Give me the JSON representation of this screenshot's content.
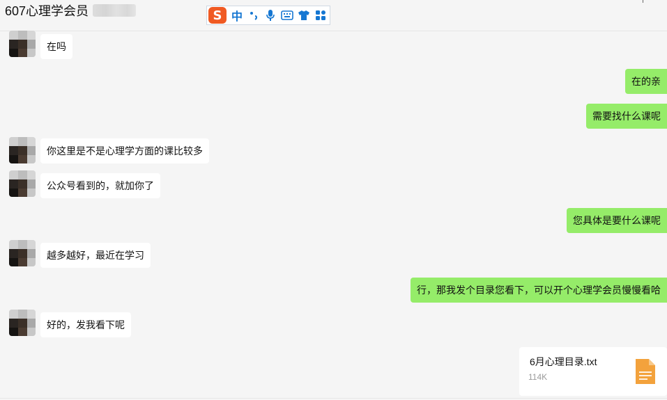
{
  "header": {
    "title": "607心理学会员"
  },
  "ime": {
    "logo": "S",
    "mode": "中",
    "icons": [
      "punctuation-icon",
      "microphone-icon",
      "keyboard-icon",
      "skin-icon",
      "toolbox-icon"
    ]
  },
  "messages": [
    {
      "side": "left",
      "text": "在吗"
    },
    {
      "side": "right",
      "text": "在的亲"
    },
    {
      "side": "right",
      "text": "需要找什么课呢"
    },
    {
      "side": "left",
      "text": "你这里是不是心理学方面的课比较多"
    },
    {
      "side": "left",
      "text": "公众号看到的，就加你了"
    },
    {
      "side": "right",
      "text": "您具体是要什么课呢"
    },
    {
      "side": "left",
      "text": "越多越好，最近在学习"
    },
    {
      "side": "right",
      "text": "行，那我发个目录您看下，可以开个心理学会员慢慢看哈"
    },
    {
      "side": "left",
      "text": "好的，发我看下呢"
    }
  ],
  "file": {
    "name": "6月心理目录.txt",
    "size": "114K"
  },
  "colors": {
    "background": "#f5f5f5",
    "bubble_left": "#ffffff",
    "bubble_right": "#95ec69",
    "ime_logo": "#f05a23",
    "ime_accent": "#1677d2",
    "file_icon": "#f3a23c"
  }
}
